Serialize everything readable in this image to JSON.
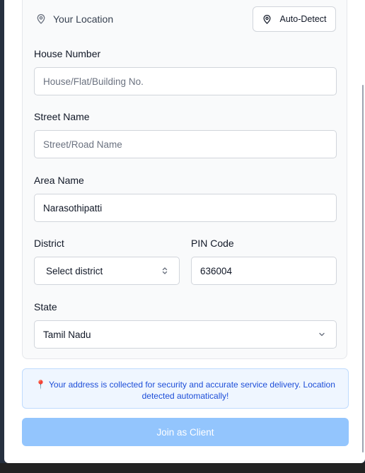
{
  "location": {
    "heading": "Your Location",
    "auto_detect_label": "Auto-Detect"
  },
  "form": {
    "house": {
      "label": "House Number",
      "value": "",
      "placeholder": "House/Flat/Building No."
    },
    "street": {
      "label": "Street Name",
      "value": "",
      "placeholder": "Street/Road Name"
    },
    "area": {
      "label": "Area Name",
      "value": "Narasothipatti",
      "placeholder": ""
    },
    "district": {
      "label": "District",
      "selected": "Select district"
    },
    "pin": {
      "label": "PIN Code",
      "value": "636004",
      "placeholder": ""
    },
    "state": {
      "label": "State",
      "selected": "Tamil Nadu"
    }
  },
  "info_note": {
    "icon": "map-pin-icon",
    "text": "Your address is collected for security and accurate service delivery. Location detected automatically!"
  },
  "submit_label": "Join as Client",
  "colors": {
    "accent_disabled": "#93c5fd",
    "info_bg": "#eff6ff",
    "info_text": "#1d4ed8"
  }
}
